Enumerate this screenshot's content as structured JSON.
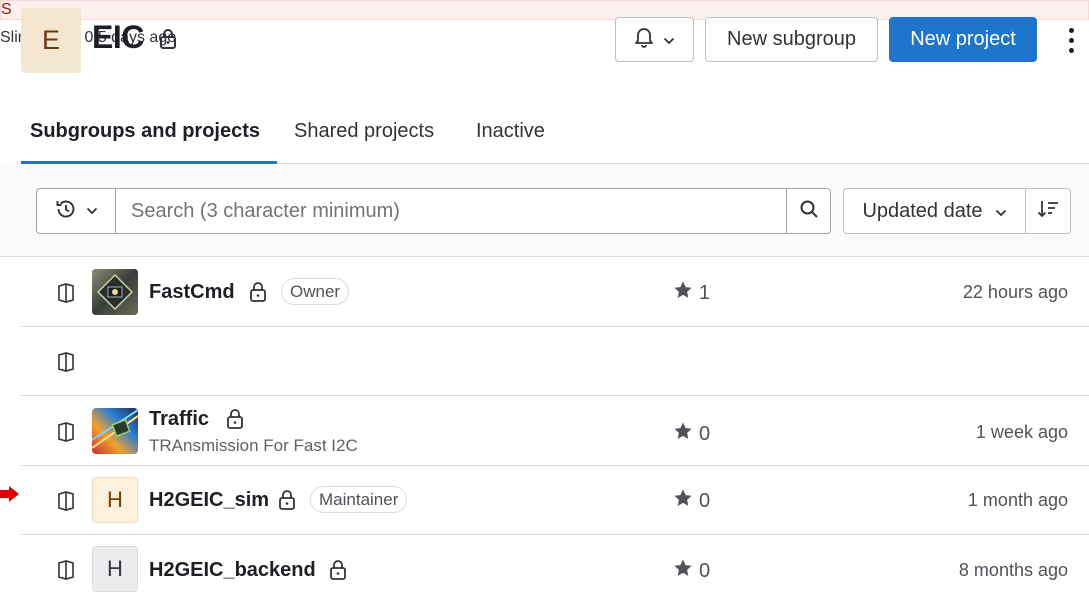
{
  "group": {
    "avatar_letter": "E",
    "name": "EIC"
  },
  "header": {
    "new_subgroup_label": "New subgroup",
    "new_project_label": "New project"
  },
  "tabs": [
    {
      "label": "Subgroups and projects",
      "active": true
    },
    {
      "label": "Shared projects",
      "active": false
    },
    {
      "label": "Inactive",
      "active": false
    }
  ],
  "filter": {
    "search_placeholder": "Search (3 character minimum)",
    "sort_label": "Updated date"
  },
  "projects": [
    {
      "name": "FastCmd",
      "role": "Owner",
      "description": "",
      "stars": "1",
      "updated": "22 hours ago",
      "avatar_letter": ""
    },
    {
      "name": "Slim",
      "role": "",
      "description": "",
      "stars": "0",
      "updated": "5 days ago",
      "avatar_letter": "S"
    },
    {
      "name": "Traffic",
      "role": "",
      "description": "TRAnsmission For Fast I2C",
      "stars": "0",
      "updated": "1 week ago",
      "avatar_letter": ""
    },
    {
      "name": "H2GEIC_sim",
      "role": "Maintainer",
      "description": "",
      "stars": "0",
      "updated": "1 month ago",
      "avatar_letter": "H"
    },
    {
      "name": "H2GEIC_backend",
      "role": "",
      "description": "",
      "stars": "0",
      "updated": "8 months ago",
      "avatar_letter": "H"
    }
  ],
  "colors": {
    "primary": "#1f75cb",
    "annotation_arrow": "#e00000"
  }
}
